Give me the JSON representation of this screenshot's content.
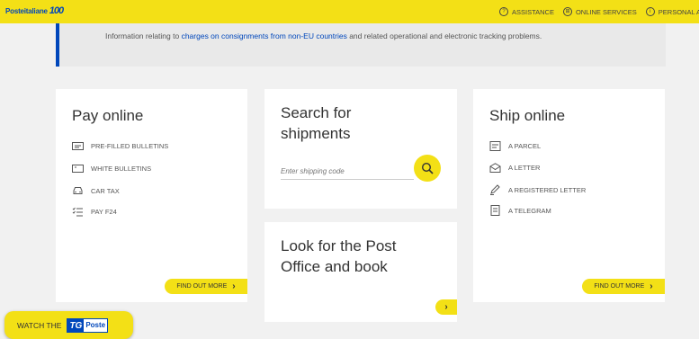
{
  "header": {
    "logo_text": "Posteitaliane",
    "logo_badge": "100",
    "nav": [
      {
        "icon": "question-icon",
        "label": "ASSISTANCE"
      },
      {
        "icon": "grid-icon",
        "label": "ONLINE SERVICES"
      },
      {
        "icon": "user-icon",
        "label": "PERSONAL AREA"
      }
    ]
  },
  "banner": {
    "text_before": "Information relating to ",
    "link": "charges on consignments from non-EU countries",
    "text_after": " and related operational and electronic tracking problems."
  },
  "pay": {
    "title": "Pay online",
    "items": [
      "PRE-FILLED BULLETINS",
      "WHITE BULLETINS",
      "CAR TAX",
      "PAY F24"
    ],
    "button": "FIND OUT MORE"
  },
  "search": {
    "title_line1": "Search for",
    "title_line2": "shipments",
    "placeholder": "Enter shipping code"
  },
  "post_office": {
    "title_line1": "Look for the Post",
    "title_line2": "Office and book"
  },
  "ship": {
    "title": "Ship online",
    "items": [
      "A PARCEL",
      "A LETTER",
      "A REGISTERED LETTER",
      "A TELEGRAM"
    ],
    "button": "FIND OUT MORE"
  },
  "watch": {
    "label": "WATCH THE",
    "tc_a": "TG",
    "tc_b": "Poste"
  },
  "colors": {
    "accent": "#f3e016",
    "brand_blue": "#0047bb"
  }
}
